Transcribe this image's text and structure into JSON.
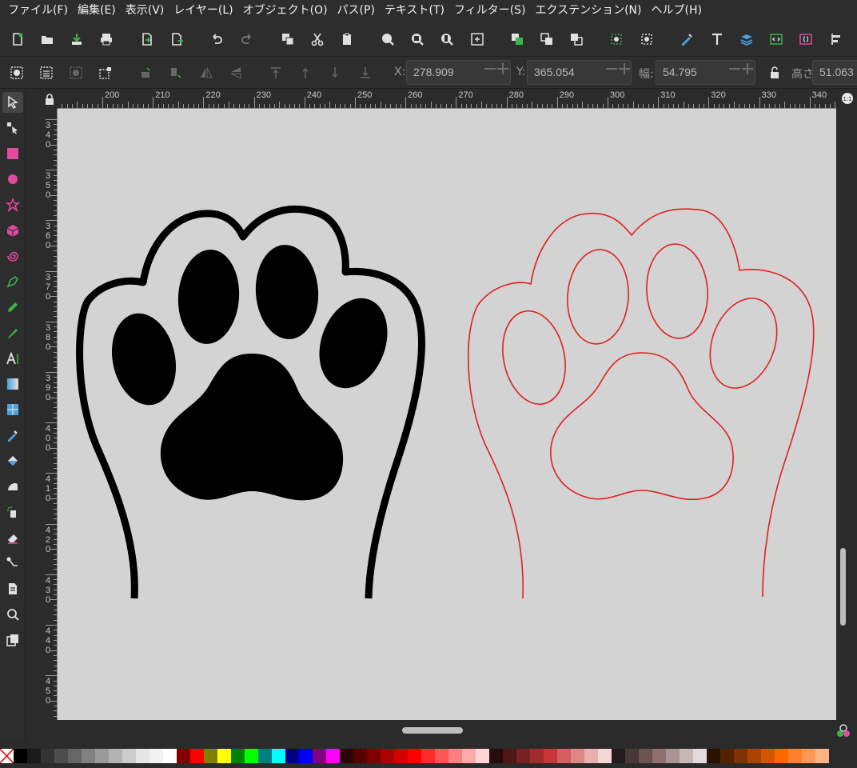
{
  "menu": [
    {
      "label": "ファイル(F)"
    },
    {
      "label": "編集(E)"
    },
    {
      "label": "表示(V)"
    },
    {
      "label": "レイヤー(L)"
    },
    {
      "label": "オブジェクト(O)"
    },
    {
      "label": "パス(P)"
    },
    {
      "label": "テキスト(T)"
    },
    {
      "label": "フィルター(S)"
    },
    {
      "label": "エクステンション(N)"
    },
    {
      "label": "ヘルプ(H)"
    }
  ],
  "tool_controls": {
    "x_label": "X:",
    "x_value": "278.909",
    "y_label": "Y:",
    "y_value": "365.054",
    "w_label": "幅:",
    "w_value": "54.795",
    "h_label": "高さ:",
    "h_value": "51.063"
  },
  "ruler": {
    "h_labels": [
      "200",
      "210",
      "220",
      "230",
      "240",
      "250",
      "260",
      "270",
      "280",
      "290",
      "300",
      "310",
      "320",
      "330",
      "340"
    ],
    "v_labels": [
      "3",
      "4",
      "0",
      "3",
      "5",
      "0",
      "3",
      "6",
      "0",
      "3",
      "7",
      "0",
      "3",
      "8",
      "0",
      "3",
      "9",
      "0",
      "4",
      "0",
      "0",
      "4",
      "1",
      "0",
      "4",
      "2",
      "0",
      "4",
      "3",
      "0",
      "4",
      "4",
      "0",
      "4",
      "5",
      "0"
    ]
  },
  "canvas": {
    "filled_paw": {
      "fill": "#000000",
      "outline": "#000000"
    },
    "outline_paw": {
      "stroke": "#e02020"
    },
    "background": "#d3d3d3"
  },
  "icons": {
    "commands": [
      "new-document-icon",
      "open-icon",
      "save-icon",
      "print-icon",
      "import-icon",
      "export-icon",
      "undo-icon",
      "redo-icon",
      "copy-icon",
      "cut-icon",
      "paste-icon",
      "zoom-selection-icon",
      "zoom-drawing-icon",
      "zoom-page-icon",
      "zoom-page-width-icon",
      "duplicate-icon",
      "clone-icon",
      "unlink-clone-icon",
      "group-icon",
      "ungroup-icon",
      "fill-stroke-icon",
      "text-font-icon",
      "layers-icon",
      "xml-editor-icon",
      "selectors-css-icon",
      "align-icon"
    ],
    "tools": [
      "selector-icon",
      "node-icon",
      "rectangle-icon",
      "ellipse-icon",
      "star-icon",
      "box3d-icon",
      "spiral-icon",
      "pen-icon",
      "pencil-icon",
      "calligraphy-icon",
      "text-icon",
      "gradient-icon",
      "mesh-icon",
      "dropper-icon",
      "paint-bucket-icon",
      "tweak-icon",
      "spray-icon",
      "eraser-icon",
      "connector-icon",
      "pages-icon",
      "zoom-icon",
      "measure-icon"
    ]
  },
  "palette": [
    "#000000",
    "#1a1a1a",
    "#333333",
    "#4d4d4d",
    "#666666",
    "#808080",
    "#999999",
    "#b3b3b3",
    "#cccccc",
    "#e6e6e6",
    "#f2f2f2",
    "#ffffff",
    "#800000",
    "#ff0000",
    "#808000",
    "#ffff00",
    "#008000",
    "#00ff00",
    "#008080",
    "#00ffff",
    "#000080",
    "#0000ff",
    "#800080",
    "#ff00ff",
    "#2b0000",
    "#550000",
    "#800000",
    "#aa0000",
    "#d40000",
    "#ff0000",
    "#ff2a2a",
    "#ff5555",
    "#ff8080",
    "#ffaaaa",
    "#ffd5d5",
    "#280b0b",
    "#501616",
    "#782121",
    "#a02c2c",
    "#c83737",
    "#d35f5f",
    "#de8787",
    "#e9afaf",
    "#f4d7d7",
    "#241c1c",
    "#483737",
    "#6c5353",
    "#916f6f",
    "#ac9393",
    "#c8b7b7",
    "#e3dbdb",
    "#2b1100",
    "#552200",
    "#803300",
    "#aa4400",
    "#d45500",
    "#ff6600",
    "#ff7f2a",
    "#ff9955",
    "#ffb380"
  ]
}
